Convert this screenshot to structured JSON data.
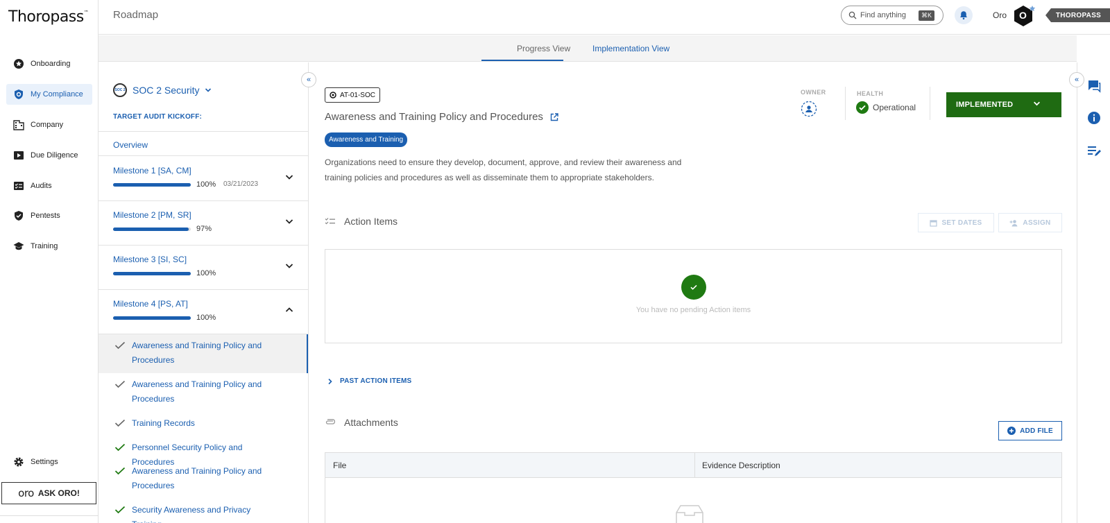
{
  "app": {
    "logo": "Thoropass",
    "logo_tm": "™",
    "page_title": "Roadmap"
  },
  "nav": {
    "items": [
      {
        "label": "Onboarding",
        "icon": "star-badge-icon"
      },
      {
        "label": "My Compliance",
        "icon": "shield-icon",
        "active": true
      },
      {
        "label": "Company",
        "icon": "building-icon"
      },
      {
        "label": "Due Diligence",
        "icon": "video-icon"
      },
      {
        "label": "Audits",
        "icon": "checklist-icon"
      },
      {
        "label": "Pentests",
        "icon": "shield-check-icon"
      },
      {
        "label": "Training",
        "icon": "graduation-cap-icon"
      }
    ],
    "settings": "Settings",
    "ask_oro_logo": "oro",
    "ask_oro": "ASK ORO!"
  },
  "header": {
    "search_placeholder": "Find anything",
    "search_shortcut": "⌘K",
    "user_name": "Oro",
    "avatar_letter": "O",
    "brand_tag": "THOROPASS"
  },
  "tabs": {
    "progress": "Progress View",
    "implementation": "Implementation View"
  },
  "milestones_panel": {
    "framework": "SOC 2 Security",
    "framework_badge": "SOC 2",
    "kickoff_label": "TARGET AUDIT KICKOFF:",
    "overview": "Overview",
    "milestones": [
      {
        "name": "Milestone 1 [SA, CM]",
        "progress": 100,
        "pct_label": "100%",
        "date": "03/21/2023",
        "expanded": false
      },
      {
        "name": "Milestone 2 [PM, SR]",
        "progress": 97,
        "pct_label": "97%",
        "date": "",
        "expanded": false
      },
      {
        "name": "Milestone 3 [SI, SC]",
        "progress": 100,
        "pct_label": "100%",
        "date": "",
        "expanded": false
      },
      {
        "name": "Milestone 4 [PS, AT]",
        "progress": 100,
        "pct_label": "100%",
        "date": "",
        "expanded": true
      }
    ],
    "controls": [
      {
        "label": "Awareness and Training Policy and Procedures",
        "selected": true,
        "check": "grey"
      },
      {
        "label": "Awareness and Training Policy and Procedures",
        "selected": false,
        "check": "grey"
      },
      {
        "label": "Training Records",
        "selected": false,
        "check": "grey"
      },
      {
        "label": "Personnel Security Policy and Procedures",
        "selected": false,
        "check": "green"
      },
      {
        "label": "Awareness and Training Policy and Procedures",
        "selected": false,
        "check": "green"
      },
      {
        "label": "Security Awareness and Privacy Training",
        "selected": false,
        "check": "green"
      }
    ]
  },
  "control": {
    "code": "AT-01-SOC",
    "title": "Awareness and Training Policy and Procedures",
    "tag": "Awareness and Training",
    "description": "Organizations need to ensure they develop, document, approve, and review their awareness and training policies and procedures as well as disseminate them to appropriate stakeholders.",
    "owner_label": "OWNER",
    "health_label": "HEALTH",
    "health_value": "Operational",
    "status": "IMPLEMENTED"
  },
  "action_items": {
    "heading": "Action Items",
    "set_dates": "SET DATES",
    "assign": "ASSIGN",
    "empty_text": "You have no pending Action items",
    "past_label": "PAST ACTION ITEMS"
  },
  "attachments": {
    "heading": "Attachments",
    "add_file": "ADD FILE",
    "col_file": "File",
    "col_desc": "Evidence Description"
  },
  "colors": {
    "accent": "#1b5fb0",
    "implemented": "#1f6b12",
    "operational": "#1f7a12"
  }
}
